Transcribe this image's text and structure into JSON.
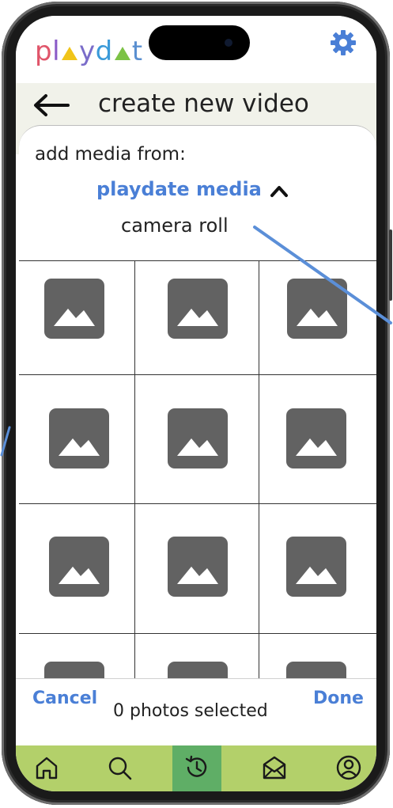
{
  "app": {
    "logo_letters": [
      "p",
      "l",
      "y",
      "d",
      "t"
    ],
    "colors": {
      "logo_p": "#e0556a",
      "logo_l": "#8a5bc7",
      "logo_y": "#7a6cc9",
      "logo_d": "#3a9ad9",
      "logo_t": "#5a8fd0",
      "logo_tri_yellow": "#f0c419",
      "logo_tri_green": "#7cc246",
      "accent_blue": "#4a7fd6",
      "nav_bar": "#b3d06a",
      "nav_active": "#5fae66",
      "header_band": "#f1f2ea",
      "placeholder_icon": "#626262"
    },
    "settings_icon": "gear-icon"
  },
  "header": {
    "back_icon": "back-arrow-icon",
    "title": "create new video"
  },
  "source_picker": {
    "prompt": "add media from:",
    "selected_source": "playdate media",
    "selected_icon": "chevron-up-icon",
    "other_source": "camera roll"
  },
  "media_grid": {
    "columns": 3,
    "visible_rows": 4,
    "tile_icon": "image-placeholder-icon"
  },
  "footer": {
    "cancel_label": "Cancel",
    "done_label": "Done",
    "selection_status": "0 photos selected"
  },
  "bottom_nav": {
    "items": [
      {
        "name": "home",
        "icon": "home-icon",
        "active": false
      },
      {
        "name": "search",
        "icon": "search-icon",
        "active": false
      },
      {
        "name": "history",
        "icon": "history-icon",
        "active": true
      },
      {
        "name": "messages",
        "icon": "mail-icon",
        "active": false
      },
      {
        "name": "profile",
        "icon": "profile-icon",
        "active": false
      }
    ]
  }
}
